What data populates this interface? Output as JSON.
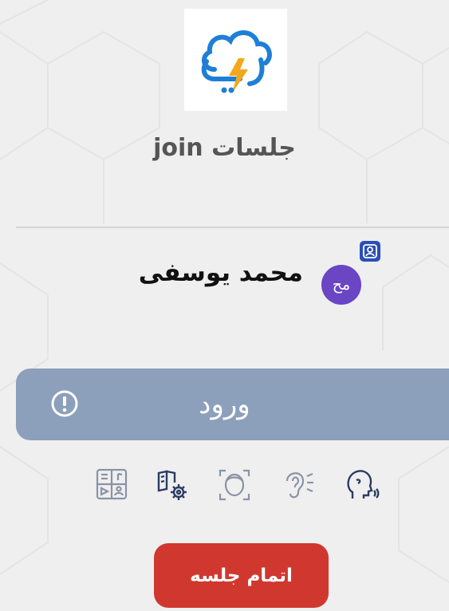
{
  "header": {
    "logo": "cloud-lightning-logo",
    "title": "جلسات join"
  },
  "user": {
    "name": "محمد یوسفی",
    "avatar_initials": "مح",
    "avatar_color": "#6a45c4",
    "badge_icon": "user-icon"
  },
  "actions": {
    "enter_label": "ورود",
    "enter_color": "#8c9fbb",
    "end_label": "اتمام جلسه",
    "end_color": "#d0382f"
  },
  "tools": [
    {
      "icon": "speech-head-icon"
    },
    {
      "icon": "ear-sound-icon"
    },
    {
      "icon": "face-scan-icon"
    },
    {
      "icon": "book-settings-icon"
    },
    {
      "icon": "media-board-icon"
    }
  ]
}
